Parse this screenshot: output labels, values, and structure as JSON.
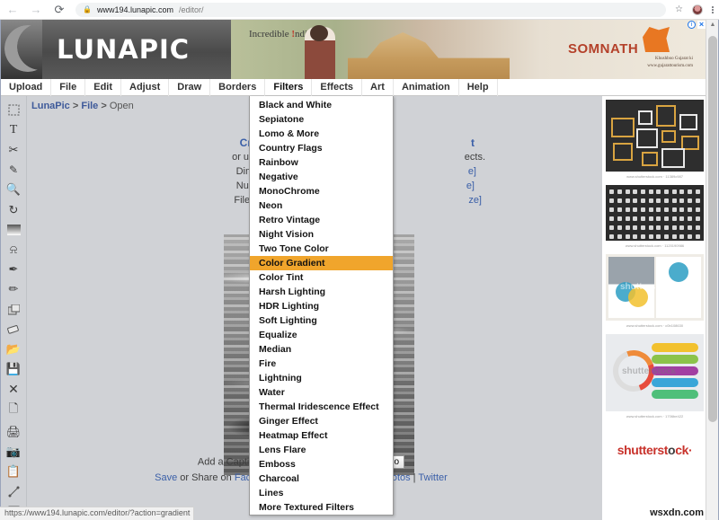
{
  "browser": {
    "url_bold": "www194.lunapic.com",
    "url_dim": "/editor/",
    "back_icon": "back-arrow-icon",
    "forward_icon": "forward-arrow-icon",
    "reload_icon": "reload-icon",
    "lock_icon": "lock-icon",
    "star_icon": "bookmark-star-icon",
    "menu_icon": "kebab-menu-icon"
  },
  "banner": {
    "logo_text": "LUNAPIC",
    "ad_tagline": "Incredible ",
    "ad_tagline_accent": "!",
    "ad_tagline_rest": "ndia",
    "ad_title": "SOMNATH",
    "ad_site": "www.gujarattourism.com",
    "ad_script": "Khushboo Gujarat ki",
    "ad_info_icon": "ad-info-icon",
    "ad_close_icon": "ad-close-icon"
  },
  "menubar": {
    "items": [
      {
        "label": "Upload"
      },
      {
        "label": "File"
      },
      {
        "label": "Edit"
      },
      {
        "label": "Adjust"
      },
      {
        "label": "Draw"
      },
      {
        "label": "Borders"
      },
      {
        "label": "Filters"
      },
      {
        "label": "Effects"
      },
      {
        "label": "Art"
      },
      {
        "label": "Animation"
      },
      {
        "label": "Help"
      }
    ]
  },
  "toolbar": {
    "tools": [
      {
        "name": "marquee-select-icon"
      },
      {
        "name": "text-tool-icon"
      },
      {
        "name": "scissors-cut-icon"
      },
      {
        "name": "eyedropper-icon"
      },
      {
        "name": "magnifier-zoom-icon"
      },
      {
        "name": "rotate-refresh-icon"
      },
      {
        "name": "gradient-icon"
      },
      {
        "name": "paint-bucket-icon"
      },
      {
        "name": "pen-tool-icon"
      },
      {
        "name": "pencil-icon"
      },
      {
        "name": "layers-icon"
      },
      {
        "name": "eraser-icon"
      },
      {
        "name": "open-folder-icon"
      },
      {
        "name": "save-disk-icon"
      },
      {
        "name": "close-x-icon"
      },
      {
        "name": "new-page-icon"
      },
      {
        "name": "print-icon"
      },
      {
        "name": "camera-icon"
      },
      {
        "name": "copy-icon"
      },
      {
        "name": "line-tool-icon"
      },
      {
        "name": "rectangle-tool-icon"
      }
    ]
  },
  "editor": {
    "breadcrumb": {
      "root": "LunaPic",
      "sep1": " > ",
      "section": "File",
      "sep2": " > ",
      "current": "Open"
    },
    "line_you": "Y",
    "line_crop": "Cro",
    "line_crop_end": "t",
    "line_use": "or use ",
    "line_use_end": "ects.",
    "line_dimensions": "Dime",
    "line_dimensions_end": "e]",
    "line_number": "Num",
    "line_number_end": "e]",
    "line_filesize": "File Si",
    "line_filesize_end": "ze]",
    "line_filename": "Fi",
    "caption_label": "Add a Caption:",
    "caption_value": "",
    "caption_placeholder": "",
    "go_label": "Go",
    "share_save": "Save",
    "share_or": " or Share on ",
    "share_facebook": "FaceB",
    "share_google": "gle Photos",
    "share_pipe": " | ",
    "share_twitter": "Twitter",
    "photo_alt": "grayscale-water-photo"
  },
  "dropdown": {
    "title": "Filters",
    "selected": "Color Gradient",
    "highlight_color": "#f0a52c",
    "items": [
      {
        "label": "Black and White"
      },
      {
        "label": "Sepiatone"
      },
      {
        "label": "Lomo & More"
      },
      {
        "label": "Country Flags"
      },
      {
        "label": "Rainbow"
      },
      {
        "label": "Negative"
      },
      {
        "label": "MonoChrome"
      },
      {
        "label": "Neon"
      },
      {
        "label": "Retro Vintage"
      },
      {
        "label": "Night Vision"
      },
      {
        "label": "Two Tone Color"
      },
      {
        "label": "Color Gradient"
      },
      {
        "label": "Color Tint"
      },
      {
        "label": "Harsh Lighting"
      },
      {
        "label": "HDR Lighting"
      },
      {
        "label": "Soft Lighting"
      },
      {
        "label": "Equalize"
      },
      {
        "label": "Median"
      },
      {
        "label": "Fire"
      },
      {
        "label": "Lightning"
      },
      {
        "label": "Water"
      },
      {
        "label": "Thermal Iridescence Effect"
      },
      {
        "label": "Ginger Effect"
      },
      {
        "label": "Heatmap Effect"
      },
      {
        "label": "Lens Flare"
      },
      {
        "label": "Emboss"
      },
      {
        "label": "Charcoal"
      },
      {
        "label": "Lines"
      },
      {
        "label": "More Textured Filters"
      }
    ]
  },
  "rail": {
    "ads": [
      {
        "name": "picture-frames-ad",
        "caption": "www.shutterstock.com · 11389c987"
      },
      {
        "name": "icon-set-ad",
        "caption": "www.shutterstock.com · 1120190986"
      },
      {
        "name": "flyer-template-ad",
        "caption": "www.shutterstock.com · c0b108630"
      },
      {
        "name": "infographic-ad",
        "caption": "www.shutterstock.com · 1706be422"
      }
    ],
    "brand": "shutterst",
    "brand_mid": "o",
    "brand_end": "ck",
    "brand_dot": "·",
    "watermark": "shutterstock"
  },
  "status": {
    "url": "https://www194.lunapic.com/editor/?action=gradient"
  },
  "watermark": {
    "text": "wsxdn.com"
  }
}
